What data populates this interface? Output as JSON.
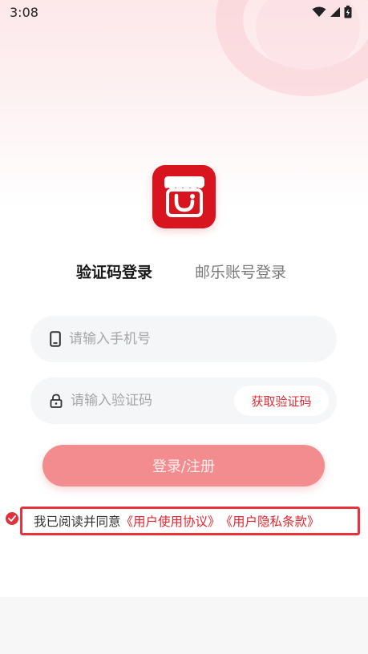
{
  "status_bar": {
    "time": "3:08",
    "icons": [
      "wifi-icon",
      "signal-icon",
      "battery-charging-icon"
    ]
  },
  "app": {
    "logo_icon": "shop-smile-logo",
    "brand_color": "#d8141f"
  },
  "tabs": [
    {
      "label": "验证码登录",
      "active": true
    },
    {
      "label": "邮乐账号登录",
      "active": false
    }
  ],
  "form": {
    "phone_placeholder": "请输入手机号",
    "phone_value": "",
    "code_placeholder": "请输入验证码",
    "code_value": "",
    "get_code_label": "获取验证码",
    "submit_label": "登录/注册"
  },
  "agreement": {
    "checked": true,
    "prefix": "我已阅读并同意",
    "user_agreement": "《用户使用协议》",
    "privacy_policy": "《用户隐私条款》"
  },
  "colors": {
    "accent": "#e0262f",
    "button_disabled": "#f28c8f",
    "field_bg": "#f5f6f8"
  }
}
